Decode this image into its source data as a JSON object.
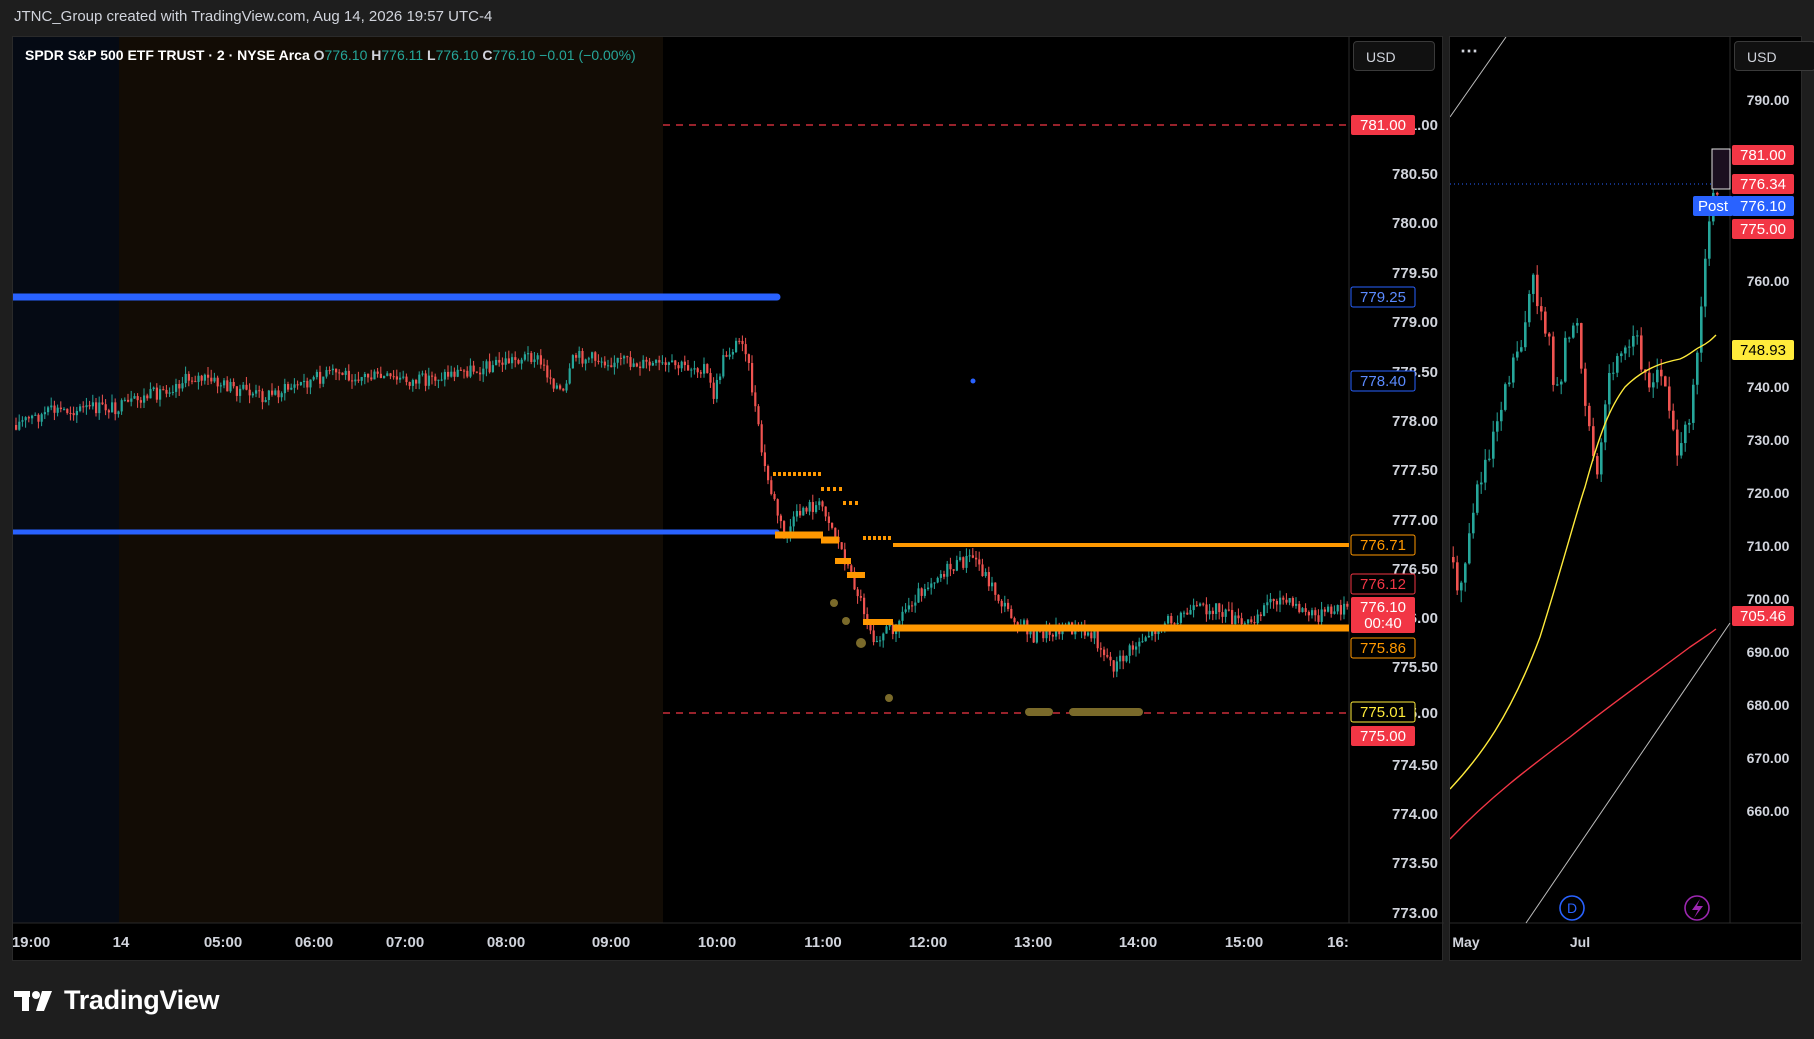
{
  "header": {
    "text": "JTNC_Group created with TradingView.com, Aug 14, 2026 19:57 UTC-4"
  },
  "main_chart": {
    "legend": {
      "symbol": "SPDR S&P 500 ETF TRUST · 2 · NYSE Arca",
      "open_key": "O",
      "open": "776.10",
      "high_key": "H",
      "high": "776.11",
      "low_key": "L",
      "low": "776.10",
      "close_key": "C",
      "close": "776.10",
      "change": "−0.01 (−0.00%)"
    },
    "currency": "USD",
    "price_axis": [
      "781.00",
      "780.50",
      "780.00",
      "779.50",
      "779.00",
      "778.50",
      "778.00",
      "777.50",
      "777.00",
      "776.50",
      "776.00",
      "775.50",
      "775.00",
      "774.50",
      "774.00",
      "773.50",
      "773.00"
    ],
    "time_axis": [
      "19:00",
      "14",
      "05:00",
      "06:00",
      "07:00",
      "08:00",
      "09:00",
      "10:00",
      "11:00",
      "12:00",
      "13:00",
      "14:00",
      "15:00",
      "16:"
    ],
    "price_labels": [
      {
        "text": "781.00",
        "style": "red"
      },
      {
        "text": "779.25",
        "style": "blue-outline"
      },
      {
        "text": "778.40",
        "style": "blue-outline"
      },
      {
        "text": "776.71",
        "style": "orange-outline"
      },
      {
        "text": "776.12",
        "style": "red-outline"
      },
      {
        "text": "776.10",
        "style": "red"
      },
      {
        "text": "00:40",
        "style": "red"
      },
      {
        "text": "775.86",
        "style": "orange-outline"
      },
      {
        "text": "775.01",
        "style": "yellow-outline"
      },
      {
        "text": "775.00",
        "style": "red"
      }
    ]
  },
  "side_chart": {
    "currency": "USD",
    "menu_icon": "ellipsis-icon",
    "price_axis": [
      "790.00",
      "780.00",
      "760.00",
      "750.00",
      "740.00",
      "730.00",
      "720.00",
      "710.00",
      "700.00",
      "690.00",
      "680.00",
      "670.00",
      "660.00"
    ],
    "time_axis": [
      "May",
      "Jul"
    ],
    "price_labels": [
      {
        "text": "781.00",
        "style": "red"
      },
      {
        "text": "776.34",
        "style": "red"
      },
      {
        "text": "Post",
        "style": "blue"
      },
      {
        "text": "776.10",
        "style": "blue"
      },
      {
        "text": "775.00",
        "style": "red"
      },
      {
        "text": "748.93",
        "style": "yellow"
      },
      {
        "text": "705.46",
        "style": "red"
      }
    ],
    "icons": [
      "dividend-icon",
      "earnings-flash-icon"
    ],
    "dividend_letter": "D"
  },
  "footer": {
    "brand": "TradingView"
  },
  "colors": {
    "background": "#000000",
    "frame": "#1e1e1e",
    "up": "#26a69a",
    "down": "#ef5350",
    "blue_level": "#2962ff",
    "orange_level": "#ff9800",
    "red_label": "#f23645",
    "yellow": "#ffeb3b"
  }
}
